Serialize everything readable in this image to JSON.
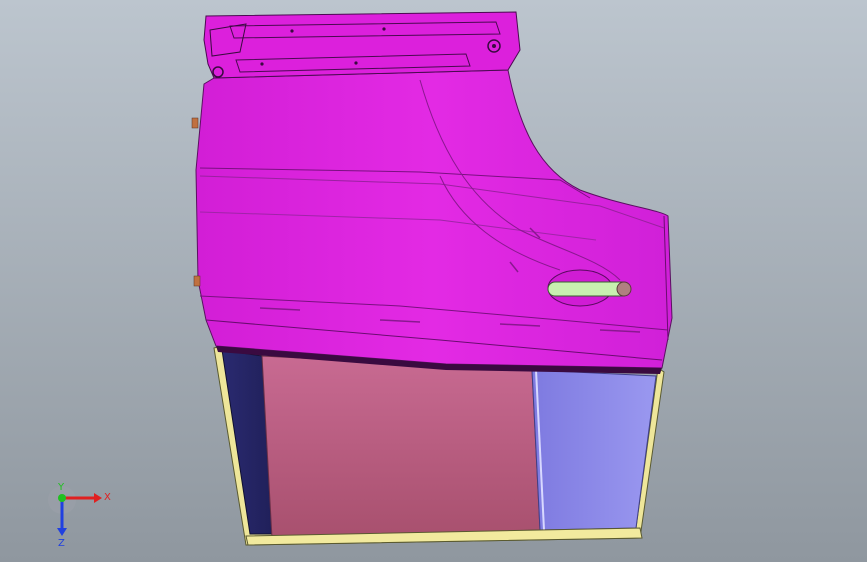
{
  "viewport": {
    "background_top": "#b9c2cb",
    "background_bottom": "#8d959e"
  },
  "model": {
    "panel_color": "#e022e0",
    "panel_dark": "#b018b8",
    "glass_left_color": "#c0658a",
    "glass_right_color": "#8a86e8",
    "frame_color": "#f0e8a0",
    "frame_dark_color": "#2a2a6e",
    "handle_color": "#c8f0b0"
  },
  "triad": {
    "x_label": "X",
    "y_label": "Y",
    "z_label": "Z",
    "x_color": "#e02020",
    "y_color": "#20c020",
    "z_color": "#2040e0"
  }
}
